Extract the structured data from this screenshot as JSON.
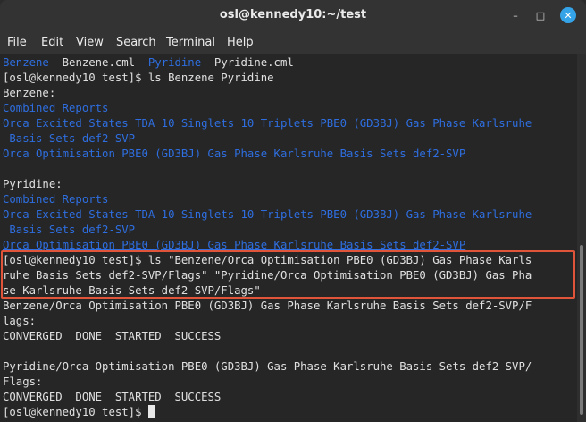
{
  "window": {
    "title": "osl@kennedy10:~/test",
    "buttons": {
      "minimize": "–",
      "maximize": "□",
      "close": "✕"
    }
  },
  "menubar": {
    "items": [
      "File",
      "Edit",
      "View",
      "Search",
      "Terminal",
      "Help"
    ]
  },
  "terminal": {
    "line0": {
      "a": "Benzene",
      "b": "  Benzene.cml  ",
      "c": "Pyridine",
      "d": "  Pyridine.cml"
    },
    "line1": "[osl@kennedy10 test]$ ls Benzene Pyridine",
    "line2": "Benzene:",
    "line3": "Combined Reports",
    "line4": "Orca Excited States TDA 10 Singlets 10 Triplets PBE0 (GD3BJ) Gas Phase Karlsruhe",
    "line5": " Basis Sets def2-SVP",
    "line6": "Orca Optimisation PBE0 (GD3BJ) Gas Phase Karlsruhe Basis Sets def2-SVP",
    "line7": "",
    "line8": "Pyridine:",
    "line9": "Combined Reports",
    "line10": "Orca Excited States TDA 10 Singlets 10 Triplets PBE0 (GD3BJ) Gas Phase Karlsruhe",
    "line11": " Basis Sets def2-SVP",
    "line12": "Orca Optimisation PBE0 (GD3BJ) Gas Phase Karlsruhe Basis Sets def2-SVP",
    "line13": "[osl@kennedy10 test]$ ls \"Benzene/Orca Optimisation PBE0 (GD3BJ) Gas Phase Karls",
    "line14": "ruhe Basis Sets def2-SVP/Flags\" \"Pyridine/Orca Optimisation PBE0 (GD3BJ) Gas Pha",
    "line15": "se Karlsruhe Basis Sets def2-SVP/Flags\"",
    "line16": "Benzene/Orca Optimisation PBE0 (GD3BJ) Gas Phase Karlsruhe Basis Sets def2-SVP/F",
    "line17": "lags:",
    "line18": "CONVERGED  DONE  STARTED  SUCCESS",
    "line19": "",
    "line20": "Pyridine/Orca Optimisation PBE0 (GD3BJ) Gas Phase Karlsruhe Basis Sets def2-SVP/",
    "line21": "Flags:",
    "line22": "CONVERGED  DONE  STARTED  SUCCESS",
    "line23": "[osl@kennedy10 test]$ "
  },
  "colors": {
    "directory": "#2e6ee0",
    "text": "#e0e0e0",
    "background": "#262626",
    "highlight_border": "#e0553a"
  }
}
